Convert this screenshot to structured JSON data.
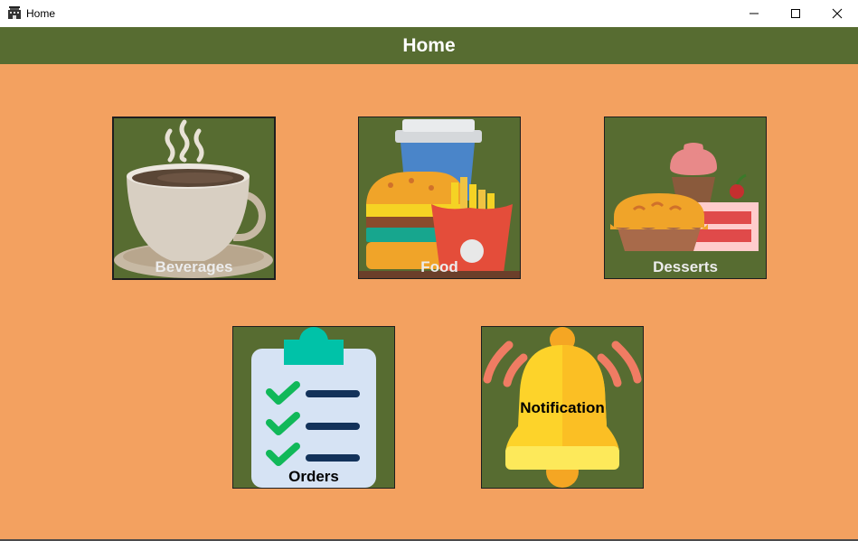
{
  "window": {
    "title": "Home",
    "icon": "building-icon",
    "controls": [
      "minimize",
      "maximize",
      "close"
    ]
  },
  "header": {
    "title": "Home",
    "background": "#576c31"
  },
  "colors": {
    "page_background": "#f3a160",
    "tile_background": "#576c31"
  },
  "tiles": [
    {
      "id": "beverages",
      "label": "Beverages",
      "icon": "coffee-cup-icon"
    },
    {
      "id": "food",
      "label": "Food",
      "icon": "burger-fries-drink-icon"
    },
    {
      "id": "desserts",
      "label": "Desserts",
      "icon": "pie-cupcake-cake-icon"
    },
    {
      "id": "orders",
      "label": "Orders",
      "icon": "clipboard-checklist-icon"
    },
    {
      "id": "notification",
      "label": "Notification",
      "icon": "ringing-bell-icon"
    }
  ]
}
